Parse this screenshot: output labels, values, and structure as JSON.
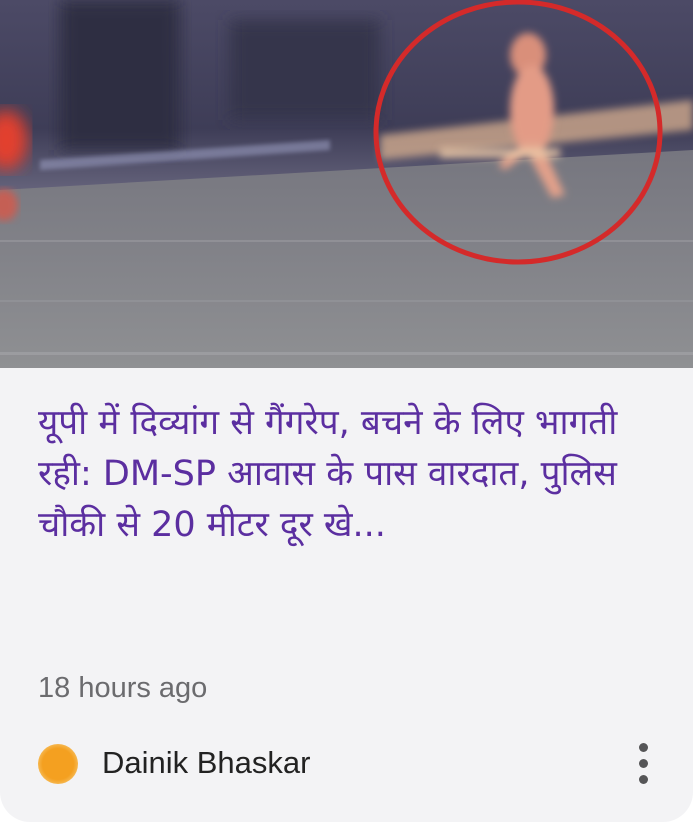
{
  "article": {
    "headline": "यूपी में दिव्यांग से गैंगरेप, बचने के लिए भागती रही: DM-SP आवास के पास वारदात, पुलिस चौकी से 20 मीटर दूर खे...",
    "time": "18 hours ago"
  },
  "source": {
    "name": "Dainik Bhaskar",
    "favicon_color": "#f4a020"
  },
  "theme": {
    "headline_color": "#5b2ea0",
    "card_background": "#f3f3f5",
    "highlight_circle_color": "#d42a2a"
  },
  "icons": {
    "more": "more-vertical-icon"
  }
}
